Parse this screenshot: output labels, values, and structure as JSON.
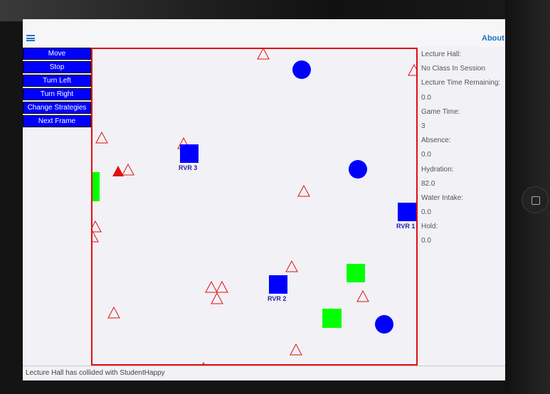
{
  "header": {
    "about_label": "About"
  },
  "controls": [
    "Move",
    "Stop",
    "Turn Left",
    "Turn Right",
    "Change Strategies",
    "Next Frame"
  ],
  "info": [
    "Lecture Hall:",
    "No Class In Session",
    "Lecture Time Remaining:",
    "0.0",
    "Game Time:",
    "3",
    "Absence:",
    "0.0",
    "Hydration:",
    "82.0",
    "Water Intake:",
    "0.0",
    "Hold:",
    "0.0"
  ],
  "status": {
    "message": "Lecture Hall has collided with StudentHappy"
  },
  "colors": {
    "accent": "#1a73c9",
    "button_bg": "#0000ff",
    "arena_border": "#e01010",
    "rover": "#0000ff",
    "station": "#00ff00",
    "hazard": "#e01010"
  },
  "icons": {
    "menu": "hamburger-menu-icon"
  },
  "arena": {
    "rovers": [
      {
        "label": "RVR 3"
      },
      {
        "label": "RVR 1"
      },
      {
        "label": "RVR 2"
      }
    ]
  }
}
